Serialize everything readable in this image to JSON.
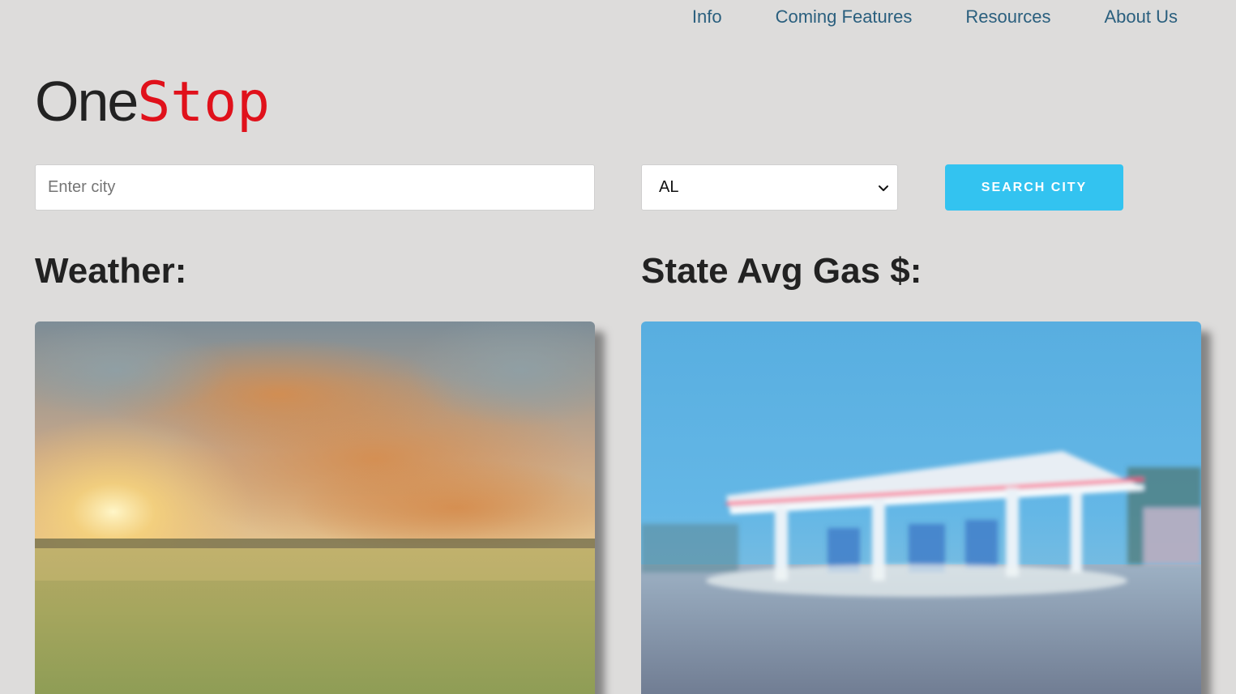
{
  "nav": {
    "items": [
      "Info",
      "Coming Features",
      "Resources",
      "About Us"
    ]
  },
  "logo": {
    "part1": "One",
    "part2": "Stop"
  },
  "search": {
    "city_placeholder": "Enter city",
    "city_value": "",
    "state_selected": "AL",
    "button_label": "SEARCH CITY"
  },
  "sections": {
    "weather_heading": "Weather:",
    "gas_heading": "State Avg Gas $:"
  },
  "colors": {
    "accent": "#33c3f0",
    "logo_red": "#e0111b",
    "nav_link": "#2a5f7e",
    "background": "#dddcdb"
  }
}
